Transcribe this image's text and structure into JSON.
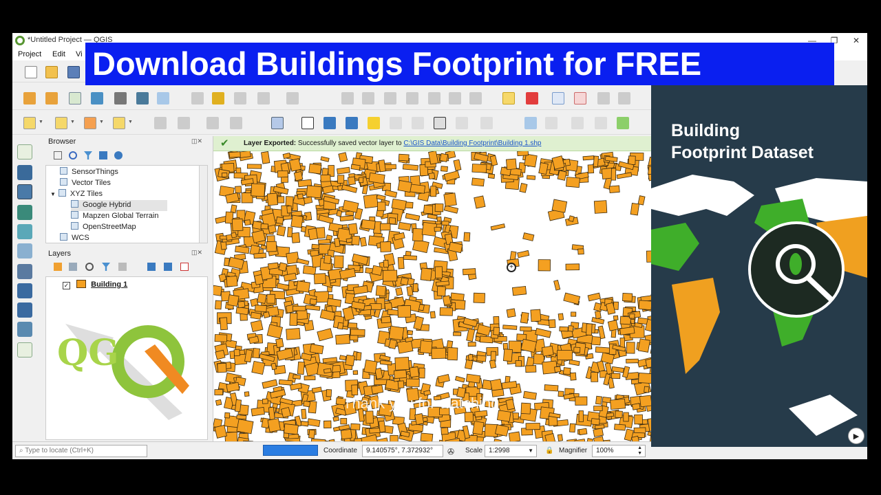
{
  "window": {
    "title": "*Untitled Project — QGIS",
    "controls": [
      "—",
      "❐",
      "✕"
    ]
  },
  "menubar": [
    "Project",
    "Edit",
    "Vi"
  ],
  "banner": {
    "text": "Download Buildings Footprint for FREE"
  },
  "browser": {
    "title": "Browser",
    "items": [
      {
        "label": "SensorThings",
        "indent": 1
      },
      {
        "label": "Vector Tiles",
        "indent": 1
      },
      {
        "label": "XYZ Tiles",
        "indent": 1,
        "expanded": true
      },
      {
        "label": "Google Hybrid",
        "indent": 2,
        "selected": true
      },
      {
        "label": "Mapzen Global Terrain",
        "indent": 2
      },
      {
        "label": "OpenStreetMap",
        "indent": 2
      },
      {
        "label": "WCS",
        "indent": 1
      }
    ]
  },
  "layers": {
    "title": "Layers",
    "items": [
      {
        "label": "Building 1",
        "checked": true,
        "color": "#f4a021"
      }
    ]
  },
  "message_bar": {
    "bold": "Layer Exported:",
    "text": "Successfully saved vector layer to",
    "link": "C:\\GIS Data\\Building Footprint\\Building 1.shp"
  },
  "status": {
    "locate_placeholder": "Type to locate (Ctrl+K)",
    "coordinate_label": "Coordinate",
    "coordinate_value": "9.140575°, 7.372932°",
    "scale_label": "Scale",
    "scale_value": "1:2998",
    "magnifier_label": "Magnifier",
    "magnifier_value": "100%"
  },
  "dataset_panel": {
    "heading_line1": "Building",
    "heading_line2": "Footprint Dataset"
  },
  "caption": "Thank you for watching",
  "colors": {
    "building_fill": "#f4a021",
    "building_stroke": "#3a2a10",
    "banner": "#0a1ff0",
    "panel_bg": "#263b4a",
    "land_orange": "#f0a020",
    "land_green": "#3fae2a",
    "land_white": "#ffffff"
  },
  "icons": [
    "qgis-logo",
    "new-project-icon",
    "open-project-icon",
    "save-project-icon",
    "pan-map-icon",
    "zoom-in-icon",
    "zoom-out-icon",
    "identify-icon",
    "select-features-icon",
    "label-icon",
    "add-vector-layer-icon",
    "add-raster-layer-icon",
    "filter-icon",
    "check-icon",
    "lock-icon",
    "render-icon",
    "play-icon",
    "magnifier-icon"
  ]
}
